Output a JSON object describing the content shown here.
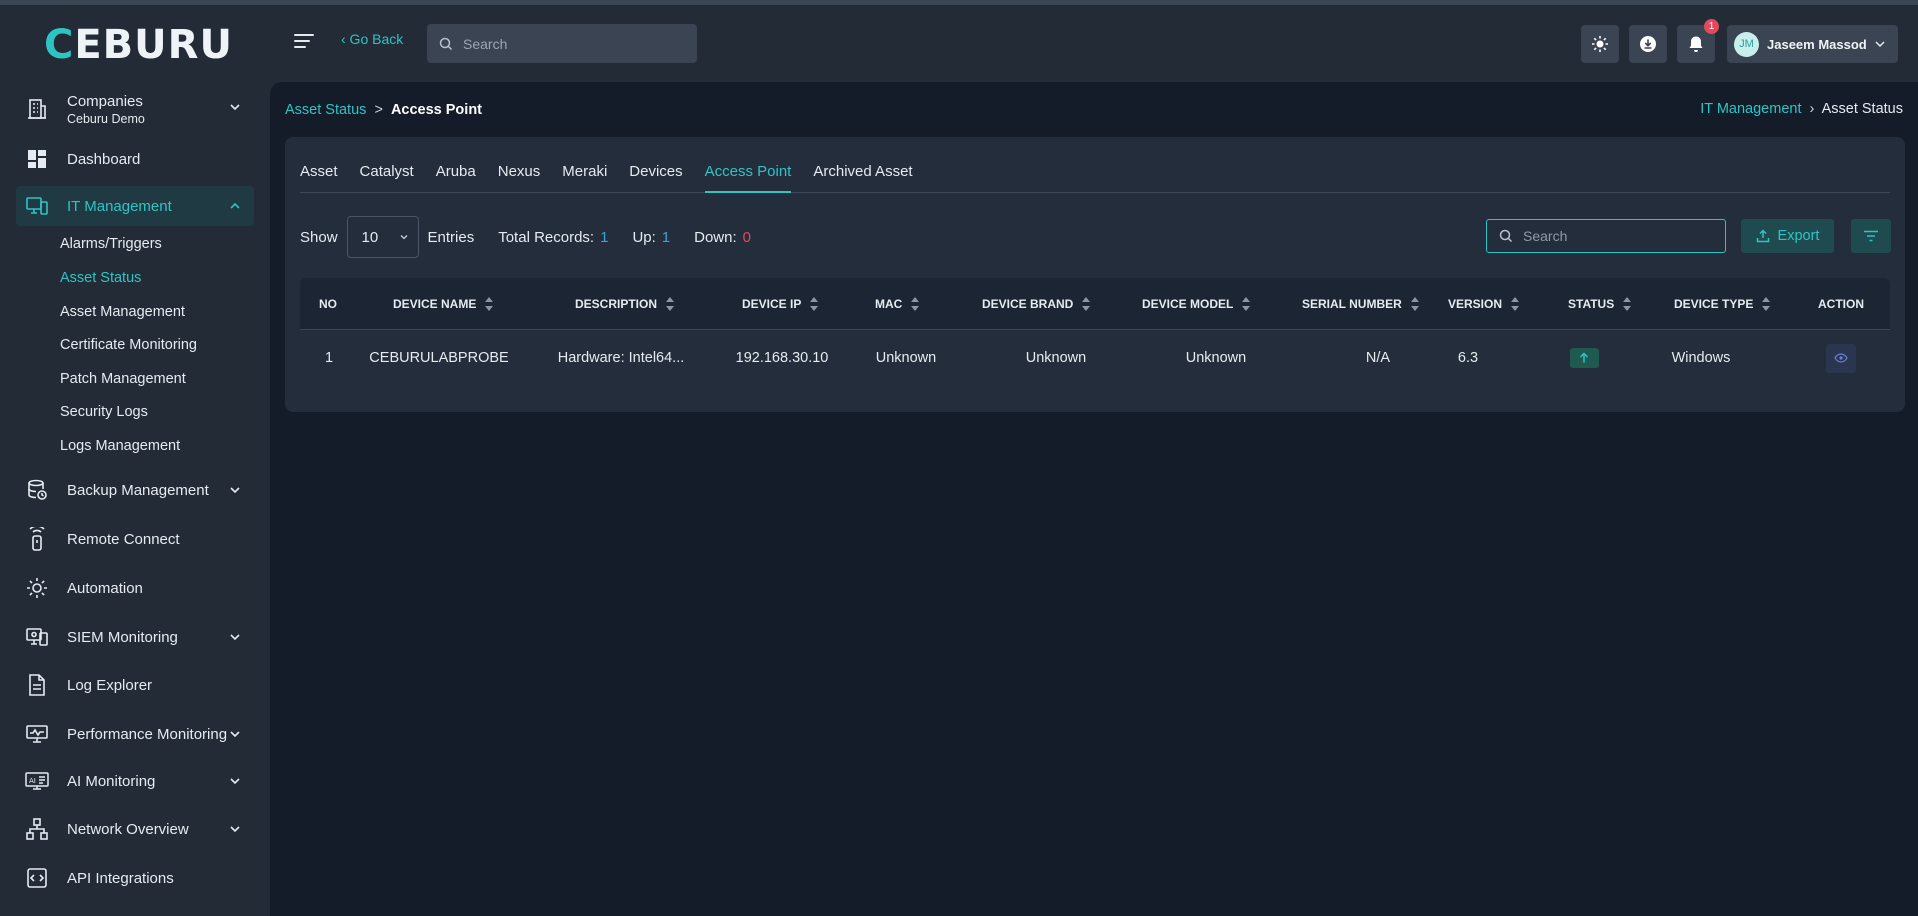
{
  "brand": {
    "logo_text": "CEBURU"
  },
  "header": {
    "go_back": "‹ Go Back",
    "search_placeholder": "Search",
    "notification_count": "1",
    "user_initials": "JM",
    "user_name": "Jaseem Massod"
  },
  "sidebar": {
    "company": {
      "label": "Companies",
      "sub": "Ceburu Demo",
      "icon": "building-icon"
    },
    "items": [
      {
        "label": "Dashboard",
        "icon": "dashboard-icon"
      },
      {
        "label": "IT Management",
        "icon": "it-management-icon",
        "active": true
      },
      {
        "label": "Backup Management",
        "icon": "backup-icon"
      },
      {
        "label": "Remote Connect",
        "icon": "remote-icon"
      },
      {
        "label": "Automation",
        "icon": "automation-gear-icon"
      },
      {
        "label": "SIEM Monitoring",
        "icon": "siem-icon"
      },
      {
        "label": "Log Explorer",
        "icon": "document-icon"
      },
      {
        "label": "Performance Monitoring",
        "icon": "monitor-icon"
      },
      {
        "label": "AI Monitoring",
        "icon": "ai-monitor-icon"
      },
      {
        "label": "Network Overview",
        "icon": "network-icon"
      },
      {
        "label": "API Integrations",
        "icon": "api-icon"
      }
    ],
    "it_sub": [
      {
        "label": "Alarms/Triggers"
      },
      {
        "label": "Asset Status",
        "active": true
      },
      {
        "label": "Asset Management"
      },
      {
        "label": "Certificate Monitoring"
      },
      {
        "label": "Patch Management"
      },
      {
        "label": "Security Logs"
      },
      {
        "label": "Logs Management"
      }
    ]
  },
  "breadcrumb": {
    "left_link": "Asset Status",
    "left_sep": ">",
    "left_current": "Access Point",
    "right_link": "IT Management",
    "right_sep": "›",
    "right_current": "Asset Status"
  },
  "tabs": [
    {
      "label": "Asset"
    },
    {
      "label": "Catalyst"
    },
    {
      "label": "Aruba"
    },
    {
      "label": "Nexus"
    },
    {
      "label": "Meraki"
    },
    {
      "label": "Devices"
    },
    {
      "label": "Access Point",
      "active": true
    },
    {
      "label": "Archived Asset"
    }
  ],
  "controls": {
    "show_label": "Show",
    "entries_value": "10",
    "entries_label": "Entries",
    "total_label": "Total Records:",
    "total_value": "1",
    "up_label": "Up:",
    "up_value": "1",
    "down_label": "Down:",
    "down_value": "0",
    "search_placeholder": "Search",
    "export_label": "Export"
  },
  "table": {
    "columns": [
      "NO",
      "DEVICE NAME",
      "DESCRIPTION",
      "DEVICE IP",
      "MAC",
      "DEVICE BRAND",
      "DEVICE MODEL",
      "SERIAL NUMBER",
      "VERSION",
      "STATUS",
      "DEVICE TYPE",
      "ACTION"
    ],
    "rows": [
      {
        "no": "1",
        "device_name": "CEBURULABPROBE",
        "description": "Hardware: Intel64...",
        "device_ip": "192.168.30.10",
        "mac": "Unknown",
        "device_brand": "Unknown",
        "device_model": "Unknown",
        "serial_number": "N/A",
        "version": "6.3",
        "status": "up",
        "device_type": "Windows"
      }
    ]
  },
  "colors": {
    "accent": "#2ec4c4",
    "danger": "#e5485d",
    "info": "#3aa3d4"
  }
}
